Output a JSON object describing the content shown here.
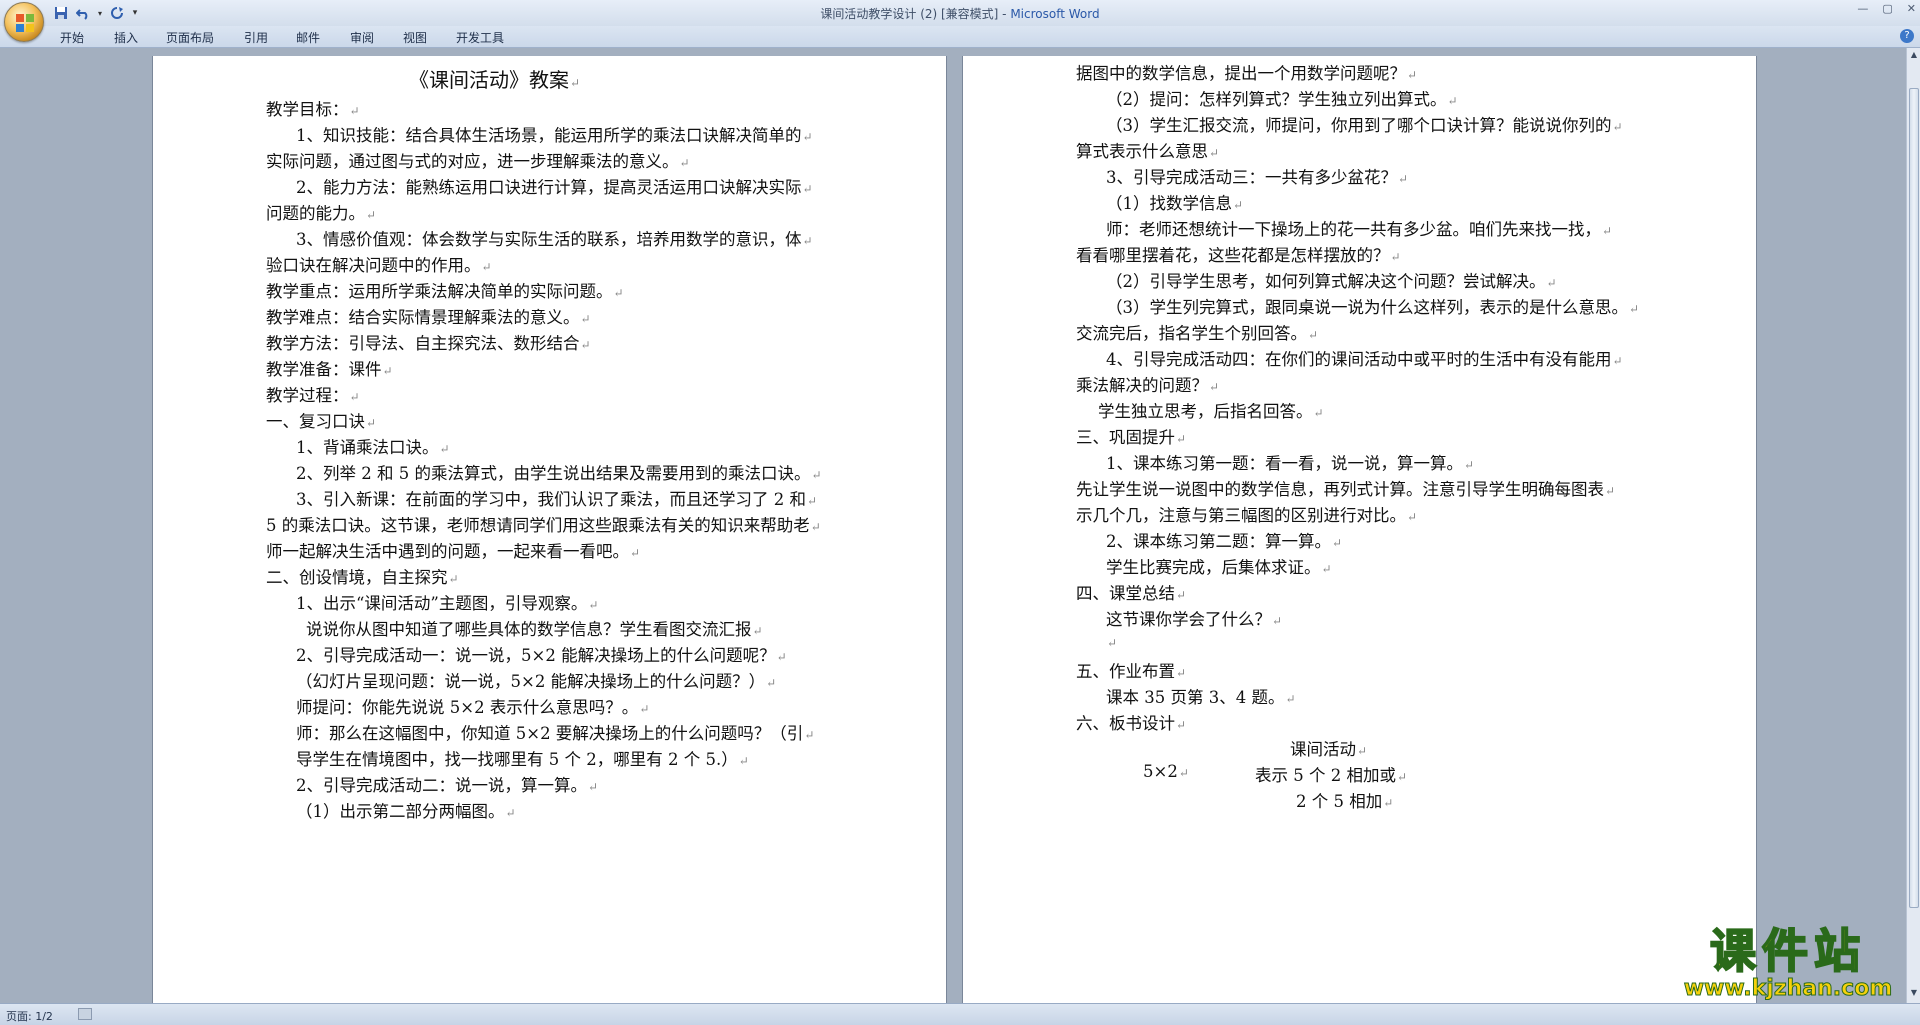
{
  "window": {
    "title_doc": "课间活动教学设计 (2) [兼容模式] - ",
    "title_app": "Microsoft Word",
    "controls": [
      "—",
      "▢",
      "✕"
    ]
  },
  "ribbon": {
    "tabs": [
      "开始",
      "插入",
      "页面布局",
      "引用",
      "邮件",
      "审阅",
      "视图",
      "开发工具"
    ],
    "help": "?"
  },
  "status": {
    "page": "页面: 1/2"
  },
  "watermark": {
    "name": "课件站",
    "url": "www.kjzhan.com"
  },
  "doc": {
    "page1": [
      "《课间活动》教案",
      "教学目标：",
      "1、知识技能：结合具体生活场景，能运用所学的乘法口诀解决简单的",
      "实际问题，通过图与式的对应，进一步理解乘法的意义。",
      "2、能力方法：能熟练运用口诀进行计算，提高灵活运用口诀解决实际",
      "问题的能力。",
      "3、情感价值观：体会数学与实际生活的联系，培养用数学的意识，体",
      "验口诀在解决问题中的作用。",
      "教学重点：运用所学乘法解决简单的实际问题。",
      "教学难点：结合实际情景理解乘法的意义。",
      "教学方法：引导法、自主探究法、数形结合",
      "教学准备：课件",
      "教学过程：",
      "一、复习口诀",
      "1、背诵乘法口诀。",
      "2、列举 2 和 5 的乘法算式，由学生说出结果及需要用到的乘法口诀。",
      "3、引入新课：在前面的学习中，我们认识了乘法，而且还学习了 2 和",
      "5 的乘法口诀。这节课，老师想请同学们用这些跟乘法有关的知识来帮助老",
      "师一起解决生活中遇到的问题，一起来看一看吧。",
      "二、创设情境，自主探究",
      "1、出示“课间活动”主题图，引导观察。",
      "说说你从图中知道了哪些具体的数学信息？学生看图交流汇报",
      "2、引导完成活动一：说一说，5×2 能解决操场上的什么问题呢？",
      "（幻灯片呈现问题：说一说，5×2 能解决操场上的什么问题？）",
      "师提问：你能先说说 5×2 表示什么意思吗？。",
      "师：那么在这幅图中，你知道 5×2 要解决操场上的什么问题吗？（引",
      "导学生在情境图中，找一找哪里有 5 个 2，哪里有 2 个 5.）",
      "2、引导完成活动二：说一说，算一算。",
      "（1）出示第二部分两幅图。"
    ],
    "page2": [
      "据图中的数学信息，提出一个用数学问题呢？",
      "（2）提问：怎样列算式？学生独立列出算式。",
      "（3）学生汇报交流，师提问，你用到了哪个口诀计算？能说说你列的",
      "算式表示什么意思",
      "3、引导完成活动三：一共有多少盆花？",
      "（1）找数学信息",
      "师：老师还想统计一下操场上的花一共有多少盆。咱们先来找一找，",
      "看看哪里摆着花，这些花都是怎样摆放的？",
      "（2）引导学生思考，如何列算式解决这个问题？尝试解决。",
      "（3）学生列完算式，跟同桌说一说为什么这样列，表示的是什么意思。",
      "交流完后，指名学生个别回答。",
      "4、引导完成活动四：在你们的课间活动中或平时的生活中有没有能用",
      "乘法解决的问题？",
      "学生独立思考，后指名回答。",
      "三、巩固提升",
      "1、课本练习第一题：看一看，说一说，算一算。",
      "先让学生说一说图中的数学信息，再列式计算。注意引导学生明确每图表",
      "示几个几，注意与第三幅图的区别进行对比。",
      "2、课本练习第二题：算一算。",
      "学生比赛完成，后集体求证。",
      "四、课堂总结",
      "这节课你学会了什么？",
      "",
      "五、作业布置",
      "课本 35 页第 3、4 题。",
      "六、板书设计",
      "课间活动",
      "5×2",
      "表示 5 个 2 相加或",
      "2 个 5 相加"
    ]
  }
}
